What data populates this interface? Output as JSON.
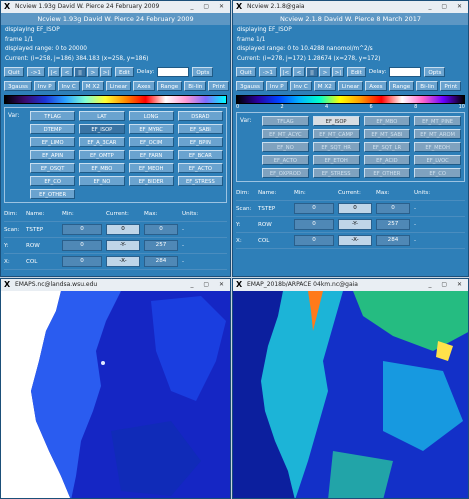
{
  "left_window": {
    "titlebar": "Ncview 1.93g David W. Pierce 24 February 2009",
    "header": "Ncview 1.93g David W. Pierce 24 February 2009",
    "displaying": "displaying EF_ISOP",
    "frame": "frame 1/1",
    "range": "displayed range: 0 to 20000",
    "current": "Current: (i=258, j=186) 384.183 (x=258, y=186)",
    "buttons": {
      "quit": "Quit",
      "next": "->1",
      "edit": "Edit",
      "delay": "Delay:",
      "opts": "Opts"
    },
    "media": [
      "|<",
      "<",
      "||",
      ">",
      ">|"
    ],
    "toolbar": [
      "3gauss",
      "Inv P",
      "Inv C",
      "M X2",
      "Linear",
      "Axes",
      "Range",
      "Bi-lin",
      "Print"
    ],
    "var_label": "Var:",
    "vars": [
      "TFLAG",
      "LAT",
      "LONG",
      "DSRAD",
      "DTEMP",
      "EF_ISOP",
      "EF_MYRC",
      "EF_SABI",
      "EF_LIMO",
      "EF_A_3CAR",
      "EF_OCIM",
      "EF_BPIN",
      "EF_APIN",
      "EF_OMTP",
      "EF_FARN",
      "EF_BCAR",
      "EF_OSQT",
      "EF_MBO",
      "EF_MEOH",
      "EF_ACTO",
      "EF_CO",
      "EF_NO",
      "EF_BIDER",
      "EF_STRESS",
      "EF_OTHER"
    ],
    "dims": {
      "headers": [
        "Dim:",
        "Name:",
        "Min:",
        "Current:",
        "Max:",
        "Units:"
      ],
      "rows": [
        {
          "dim": "Scan:",
          "name": "TSTEP",
          "min": "0",
          "current": "0",
          "max": "0",
          "units": "-"
        },
        {
          "dim": "Y:",
          "name": "ROW",
          "min": "0",
          "current": "-Y-",
          "max": "257",
          "units": "-"
        },
        {
          "dim": "X:",
          "name": "COL",
          "min": "0",
          "current": "-X-",
          "max": "284",
          "units": "-"
        }
      ]
    }
  },
  "right_window": {
    "titlebar": "Ncview 2.1.8@gaia",
    "header": "Ncview 2.1.8 David W. Pierce 8 March 2017",
    "displaying": "displaying EF_ISOP",
    "frame": "frame 1/1",
    "range": "displayed range: 0 to 10.4288 nanomol/m^2/s",
    "current": "Current: (i=278, j=172) 1.28674 (x=278, y=172)",
    "buttons": {
      "quit": "Quit",
      "next": "->1",
      "edit": "Edit",
      "delay": "Delay:",
      "opts": "Opts"
    },
    "media": [
      "|<",
      "<",
      "||",
      ">",
      ">|"
    ],
    "toolbar": [
      "3gauss",
      "Inv P",
      "Inv C",
      "M X2",
      "Linear",
      "Axes",
      "Range",
      "Bi-lin",
      "Print"
    ],
    "colorbar_ticks": [
      "0",
      "2",
      "4",
      "6",
      "8",
      "10"
    ],
    "var_label": "Var:",
    "vars": [
      "TFLAG",
      "EF_ISOP",
      "EF_MBO",
      "EF_MT_PINE",
      "EF_MT_ACYC",
      "EF_MT_CAMP",
      "EF_MT_SABI",
      "EF_MT_AROM",
      "EF_NO",
      "EF_SQT_HR",
      "EF_SQT_LR",
      "EF_MEOH",
      "EF_ACTO",
      "EF_ETOH",
      "EF_ACID",
      "EF_LVOC",
      "EF_OXPROD",
      "EF_STRESS",
      "EF_OTHER",
      "EF_CO"
    ],
    "dims": {
      "headers": [
        "Dim:",
        "Name:",
        "Min:",
        "Current:",
        "Max:",
        "Units:"
      ],
      "rows": [
        {
          "dim": "Scan:",
          "name": "TSTEP",
          "min": "0",
          "current": "0",
          "max": "0",
          "units": "-"
        },
        {
          "dim": "Y:",
          "name": "ROW",
          "min": "0",
          "current": "-Y-",
          "max": "257",
          "units": "-"
        },
        {
          "dim": "X:",
          "name": "COL",
          "min": "0",
          "current": "-X-",
          "max": "284",
          "units": "-"
        }
      ]
    }
  },
  "left_map": {
    "titlebar": "EMAPS.nc@landsa.wsu.edu"
  },
  "right_map": {
    "titlebar": "EMAP_2018b/ARPACE 04km.nc@gaia"
  },
  "colors": {
    "panel": "#2e7fb8",
    "button": "#6aa3cf",
    "map_left_bg": "#1a2fd0",
    "map_right_bg": "#1236c8"
  }
}
